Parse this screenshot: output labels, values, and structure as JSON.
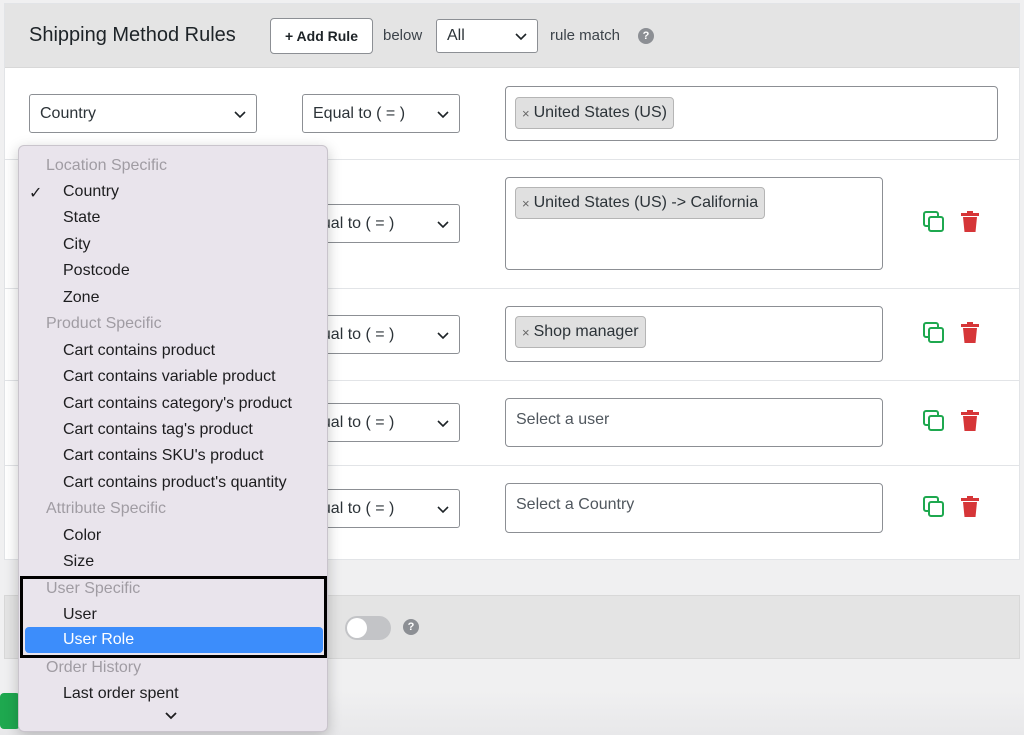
{
  "header": {
    "title": "Shipping Method Rules",
    "add_rule_label": "+ Add Rule",
    "below_text": "below",
    "match_select": "All",
    "rule_match_text": "rule match",
    "help_glyph": "?"
  },
  "rules": [
    {
      "field": "Country",
      "operator": "Equal to ( = )",
      "tags": [
        "United States (US)"
      ],
      "placeholder": ""
    },
    {
      "field": "",
      "operator": "qual to ( = )",
      "tags": [
        "United States (US) -> California"
      ],
      "placeholder": ""
    },
    {
      "field": "",
      "operator": "qual to ( = )",
      "tags": [
        "Shop manager"
      ],
      "placeholder": ""
    },
    {
      "field": "",
      "operator": "qual to ( = )",
      "tags": [],
      "placeholder": "Select a user"
    },
    {
      "field": "",
      "operator": "qual to ( = )",
      "tags": [],
      "placeholder": "Select a Country"
    }
  ],
  "tag_remove_glyph": "×",
  "dropdown": {
    "check_glyph": "✓",
    "groups": [
      {
        "label": "Location Specific",
        "items": [
          "Country",
          "State",
          "City",
          "Postcode",
          "Zone"
        ]
      },
      {
        "label": "Product Specific",
        "items": [
          "Cart contains product",
          "Cart contains variable product",
          "Cart contains category's product",
          "Cart contains tag's product",
          "Cart contains SKU's product",
          "Cart contains product's quantity"
        ]
      },
      {
        "label": "Attribute Specific",
        "items": [
          "Color",
          "Size"
        ]
      },
      {
        "label": "User Specific",
        "items": [
          "User",
          "User Role"
        ]
      },
      {
        "label": "Order History",
        "items": [
          "Last order spent"
        ]
      }
    ],
    "checked_item": "Country",
    "selected_item": "User Role"
  },
  "colors": {
    "copy_icon": "#1ea84f",
    "trash_icon": "#d63638",
    "dropdown_selected": "#3c8dfb"
  },
  "icons": {
    "copy": "copy-icon",
    "trash": "trash-icon",
    "chevron": "chevron-down-icon",
    "help": "help-icon"
  }
}
